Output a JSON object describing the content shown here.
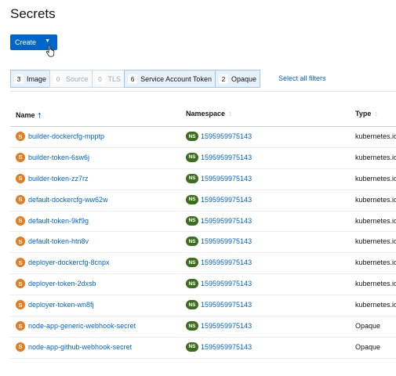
{
  "page": {
    "title": "Secrets"
  },
  "toolbar": {
    "create_label": "Create"
  },
  "filters": [
    {
      "count": "3",
      "label": "Image",
      "active": true
    },
    {
      "count": "0",
      "label": "Source",
      "active": false
    },
    {
      "count": "0",
      "label": "TLS",
      "active": false
    },
    {
      "count": "6",
      "label": "Service Account Token",
      "active": true
    },
    {
      "count": "2",
      "label": "Opaque",
      "active": true
    }
  ],
  "select_all_label": "Select all filters",
  "table": {
    "headers": {
      "name": "Name",
      "namespace": "Namespace",
      "type": "Type"
    },
    "badges": {
      "secret": "S",
      "namespace": "NS"
    },
    "rows": [
      {
        "name": "builder-dockercfg-mpptp",
        "namespace": "1595959975143",
        "type": "kubernetes.io"
      },
      {
        "name": "builder-token-6sw6j",
        "namespace": "1595959975143",
        "type": "kubernetes.io"
      },
      {
        "name": "builder-token-zz7rz",
        "namespace": "1595959975143",
        "type": "kubernetes.io"
      },
      {
        "name": "default-dockercfg-ww62w",
        "namespace": "1595959975143",
        "type": "kubernetes.io"
      },
      {
        "name": "default-token-9kf9g",
        "namespace": "1595959975143",
        "type": "kubernetes.io"
      },
      {
        "name": "default-token-htn8v",
        "namespace": "1595959975143",
        "type": "kubernetes.io"
      },
      {
        "name": "deployer-dockercfg-8cnpx",
        "namespace": "1595959975143",
        "type": "kubernetes.io"
      },
      {
        "name": "deployer-token-2dxsb",
        "namespace": "1595959975143",
        "type": "kubernetes.io"
      },
      {
        "name": "deployer-token-wn8fj",
        "namespace": "1595959975143",
        "type": "kubernetes.io"
      },
      {
        "name": "node-app-generic-webhook-secret",
        "namespace": "1595959975143",
        "type": "Opaque"
      },
      {
        "name": "node-app-github-webhook-secret",
        "namespace": "1595959975143",
        "type": "Opaque"
      }
    ]
  }
}
